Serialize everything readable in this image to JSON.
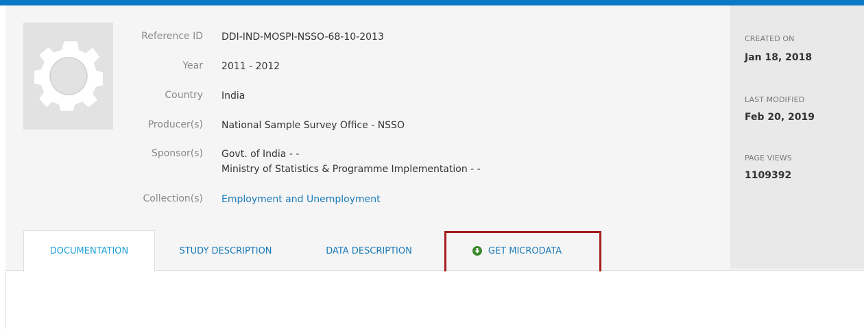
{
  "study": {
    "fields": [
      {
        "label": "Reference ID",
        "value": "DDI-IND-MOSPI-NSSO-68-10-2013"
      },
      {
        "label": "Year",
        "value": "2011 - 2012"
      },
      {
        "label": "Country",
        "value": "India"
      },
      {
        "label": "Producer(s)",
        "value": "National Sample Survey Office - NSSO"
      },
      {
        "label": "Sponsor(s)",
        "value": "Govt. of India - -",
        "value2": "Ministry of Statistics & Programme Implementation - -"
      },
      {
        "label": "Collection(s)",
        "value": "Employment and Unemployment"
      }
    ]
  },
  "side": {
    "created_label": "CREATED ON",
    "created_value": "Jan 18, 2018",
    "modified_label": "LAST MODIFIED",
    "modified_value": "Feb 20, 2019",
    "views_label": "PAGE VIEWS",
    "views_value": "1109392"
  },
  "tabs": [
    {
      "label": "DOCUMENTATION"
    },
    {
      "label": "STUDY DESCRIPTION"
    },
    {
      "label": "DATA DESCRIPTION"
    },
    {
      "label": "GET MICRODATA",
      "icon": "download-circle-icon"
    }
  ],
  "colors": {
    "accent": "#0b78c6",
    "link": "#1a7ab8",
    "highlight": "#a51d1d",
    "download_icon": "#3c8a2e"
  }
}
